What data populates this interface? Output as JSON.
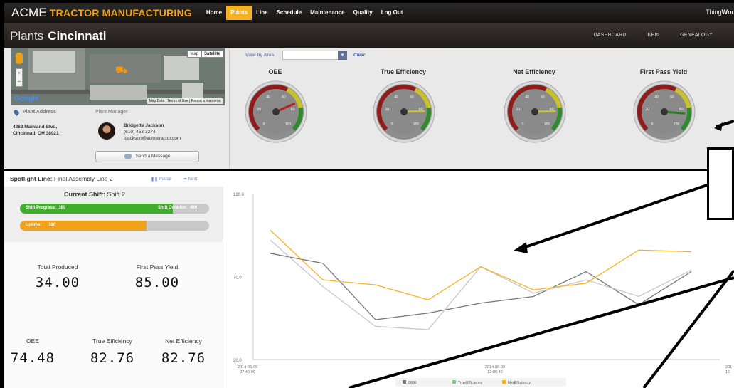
{
  "topbar": {
    "logo": "ACME",
    "brand": "TRACTOR MANUFACTURING",
    "nav": [
      "Home",
      "Plants",
      "Line",
      "Schedule",
      "Maintenance",
      "Quality",
      "Log Out"
    ],
    "active_index": 1,
    "thing_a": "Thing",
    "thing_b": "Wor"
  },
  "header": {
    "prefix": "Plants",
    "city": "Cincinnati",
    "links": [
      "DASHBOARD",
      "KPIs",
      "GENEALOGY"
    ]
  },
  "map": {
    "buttons": [
      "Map",
      "Satellite"
    ],
    "google": "Google",
    "footer": "Map Data | Terms of Use | Report a map error"
  },
  "plant": {
    "address_label": "Plant Address",
    "address": [
      "4362 Mainland Blvd,",
      "Cincinnati, OH 38921"
    ],
    "manager_label": "Plant Manager",
    "manager_name": "Bridgette Jackson",
    "manager_phone": "(610) 453-3274",
    "manager_email": "bjackson@acmetractor.com",
    "message_button": "Send a Message"
  },
  "filter": {
    "label": "View by Area",
    "value": "",
    "clear": "Clear"
  },
  "gauges": [
    {
      "title": "OEE",
      "value": 74.48,
      "ticks": [
        "0",
        "20",
        "40",
        "60",
        "80",
        "100"
      ],
      "needle_color": "#b3211f"
    },
    {
      "title": "True Efficiency",
      "value": 82.76,
      "ticks": [
        "0",
        "20",
        "40",
        "60",
        "80",
        "100"
      ],
      "needle_color": "#c9c12a"
    },
    {
      "title": "Net Efficiency",
      "value": 82.76,
      "ticks": [
        "0",
        "20",
        "40",
        "60",
        "80",
        "100"
      ],
      "needle_color": "#c9c12a"
    },
    {
      "title": "First Pass Yield",
      "value": 85.0,
      "ticks": [
        "0",
        "20",
        "40",
        "60",
        "80",
        "100"
      ],
      "needle_color": "#2a7a2a"
    }
  ],
  "spotlight": {
    "label": "Spotlight Line:",
    "line": "Final Assembly Line 2",
    "pause": "Pause",
    "next": "Next"
  },
  "shift": {
    "label": "Current Shift:",
    "value": "Shift 2",
    "progress_label": "Shift Progress:",
    "progress_value": "389",
    "duration_label": "Shift Duration:",
    "duration_value": "480",
    "progress_fraction": 0.81,
    "uptime_label": "Uptime:",
    "uptime_value": "320",
    "uptime_fraction": 0.67,
    "progress_color": "#3fae2a",
    "uptime_color": "#f0a21c"
  },
  "stats": {
    "total_produced_label": "Total Produced",
    "total_produced": "34.00",
    "fpy_label": "First Pass Yield",
    "fpy": "85.00",
    "oee_label": "OEE",
    "oee": "74.48",
    "true_eff_label": "True Efficiency",
    "true_eff": "82.76",
    "net_eff_label": "Net Efficiency",
    "net_eff": "82.76"
  },
  "chart_data": {
    "type": "line",
    "ylim": [
      20,
      120
    ],
    "yticks": [
      "20.0",
      "70.0",
      "120.0"
    ],
    "xtick_labels": [
      [
        "2014-06-09",
        "07:40:00"
      ],
      [
        "2014-06-09",
        "12:06:40"
      ],
      [
        "201",
        "16"
      ]
    ],
    "series": [
      {
        "name": "OEE",
        "color": "#777777",
        "values": [
          84,
          78,
          44,
          48,
          54,
          58,
          73,
          53,
          73
        ]
      },
      {
        "name": "TrueEfficiency",
        "color": "#c8c8c8",
        "values": [
          92,
          64,
          40,
          38,
          76,
          60,
          68,
          58,
          74
        ]
      },
      {
        "name": "NetEfficiency",
        "color": "#f5b324",
        "values": [
          98,
          68,
          65,
          56,
          76,
          62,
          66,
          86,
          85
        ]
      }
    ],
    "legend_position": "bottom"
  }
}
